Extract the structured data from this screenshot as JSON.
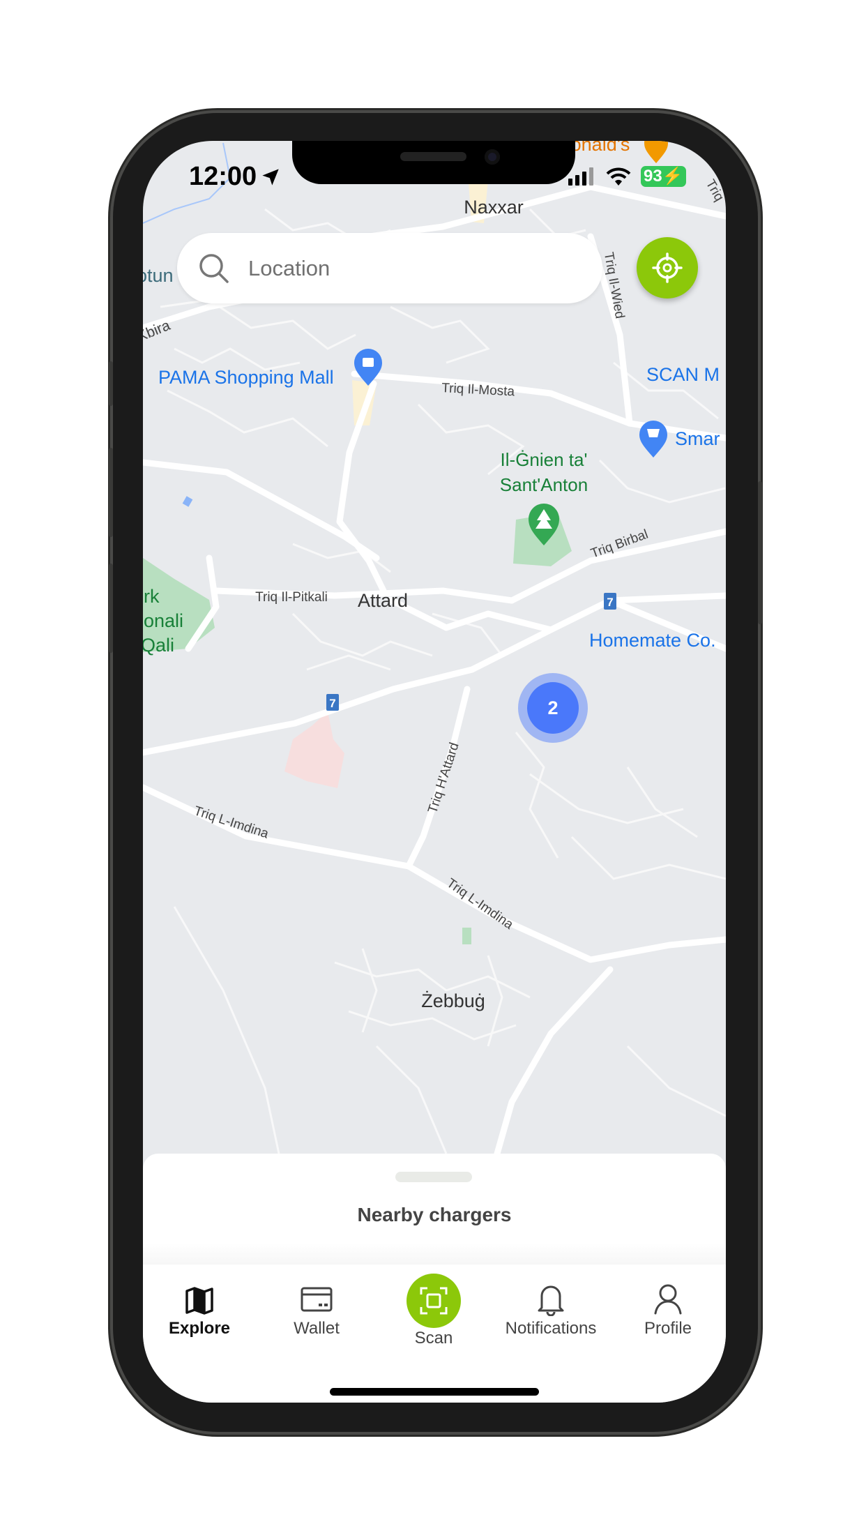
{
  "status_bar": {
    "time": "12:00",
    "battery": "93"
  },
  "search": {
    "placeholder": "Location",
    "value": ""
  },
  "map": {
    "labels": {
      "naxxar": "Naxxar",
      "otun": "otun",
      "kbira": "Kbira",
      "pama": "PAMA Shopping Mall",
      "triq_il_mosta": "Triq Il-Mosta",
      "scan_m": "SCAN M",
      "smar": "Smar",
      "gnien_line1": "Il-Ġnien ta'",
      "gnien_line2": "Sant'Anton",
      "triq_birbal": "Triq Birbal",
      "triq_il_pitkali": "Triq Il-Pitkali",
      "attard": "Attard",
      "park_line1": "rk",
      "park_line2": "ionali",
      "park_line3": "Qali",
      "homemate": "Homemate Co.",
      "route_7a": "7",
      "route_7b": "7",
      "triq_h_attard": "Triq H'Attard",
      "triq_l_imdina_1": "Triq L-Imdina",
      "triq_l_imdina_2": "Triq L-Imdina",
      "zebbug": "Żebbuġ",
      "mcdonalds": "onald's",
      "triq_il_wied": "Triq Il-Wied",
      "triq_top": "Triq"
    },
    "cluster_count": "2",
    "colors": {
      "background": "#e8eaed",
      "road": "#ffffff",
      "park": "#b8dfc0",
      "poi_blue": "#1a73e8",
      "poi_green": "#188038",
      "cluster": "#4a78fa",
      "accent": "#8cc80a"
    }
  },
  "sheet": {
    "title": "Nearby chargers"
  },
  "nav": {
    "items": [
      {
        "label": "Explore",
        "icon": "map-icon",
        "active": true
      },
      {
        "label": "Wallet",
        "icon": "wallet-icon"
      },
      {
        "label": "Scan",
        "icon": "scan-icon"
      },
      {
        "label": "Notifications",
        "icon": "bell-icon"
      },
      {
        "label": "Profile",
        "icon": "user-icon"
      }
    ]
  }
}
